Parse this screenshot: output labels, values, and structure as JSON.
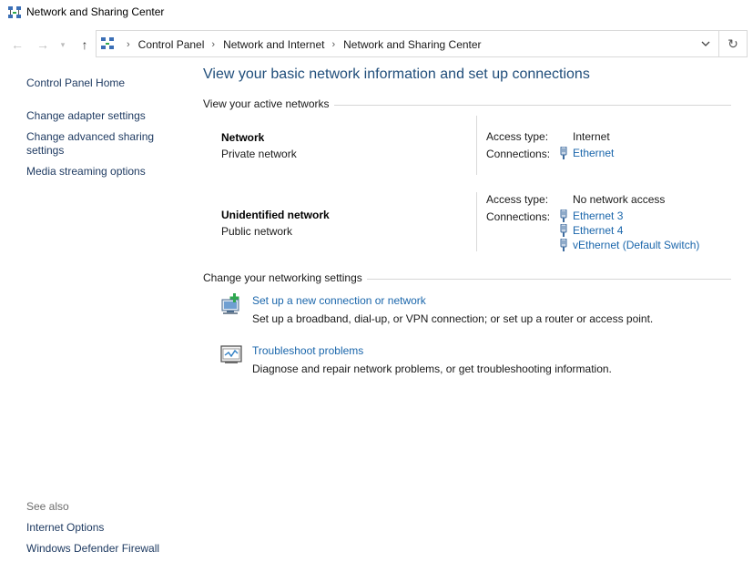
{
  "window": {
    "title": "Network and Sharing Center"
  },
  "icons": {
    "app": "network-sharing-icon",
    "back": "back-arrow-icon",
    "forward": "forward-arrow-icon",
    "recent": "chevron-down-icon",
    "up": "up-arrow-icon",
    "location": "control-panel-icon",
    "address_dropdown": "chevron-down-icon",
    "refresh": "refresh-icon",
    "connection": "ethernet-icon",
    "setup_task": "new-connection-icon",
    "troubleshoot_task": "troubleshoot-icon"
  },
  "address": {
    "crumbs": [
      "Control Panel",
      "Network and Internet",
      "Network and Sharing Center"
    ]
  },
  "sidebar": {
    "home": "Control Panel Home",
    "links": [
      "Change adapter settings",
      "Change advanced sharing settings",
      "Media streaming options"
    ],
    "see_also_title": "See also",
    "see_also": [
      "Internet Options",
      "Windows Defender Firewall"
    ]
  },
  "main": {
    "heading": "View your basic network information and set up connections",
    "active_networks_title": "View your active networks",
    "networks": [
      {
        "name": "Network",
        "category": "Private network",
        "access_label": "Access type:",
        "access_value": "Internet",
        "connections_label": "Connections:",
        "connections": [
          "Ethernet"
        ]
      },
      {
        "name": "Unidentified network",
        "category": "Public network",
        "access_label": "Access type:",
        "access_value": "No network access",
        "connections_label": "Connections:",
        "connections": [
          "Ethernet 3",
          "Ethernet 4",
          "vEthernet (Default Switch)"
        ]
      }
    ],
    "settings_title": "Change your networking settings",
    "tasks": [
      {
        "link": "Set up a new connection or network",
        "description": "Set up a broadband, dial-up, or VPN connection; or set up a router or access point."
      },
      {
        "link": "Troubleshoot problems",
        "description": "Diagnose and repair network problems, or get troubleshooting information."
      }
    ]
  },
  "colors": {
    "link": "#1a66ab",
    "heading": "#1f4d7a",
    "sidebar_link": "#1f3b62",
    "muted": "#6d6d6d"
  }
}
